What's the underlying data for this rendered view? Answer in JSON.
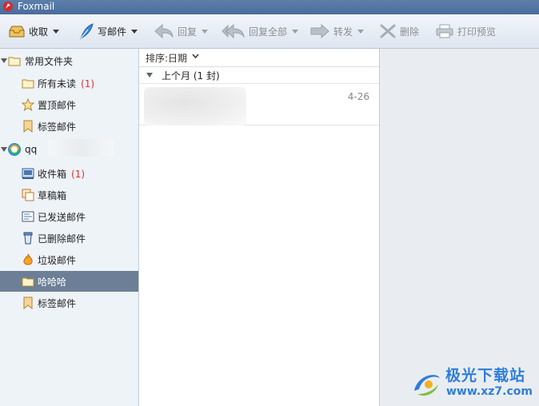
{
  "window": {
    "title": "Foxmail"
  },
  "toolbar": {
    "receive": "收取",
    "compose": "写邮件",
    "reply": "回复",
    "reply_all": "回复全部",
    "forward": "转发",
    "delete": "删除",
    "print_preview": "打印预览"
  },
  "sidebar": {
    "favorites": {
      "label": "常用文件夹",
      "items": [
        {
          "label": "所有未读",
          "count": "(1)"
        },
        {
          "label": "置顶邮件"
        },
        {
          "label": "标签邮件"
        }
      ]
    },
    "account": {
      "label": "qq",
      "items": [
        {
          "label": "收件箱",
          "count": "(1)"
        },
        {
          "label": "草稿箱"
        },
        {
          "label": "已发送邮件"
        },
        {
          "label": "已删除邮件"
        },
        {
          "label": "垃圾邮件"
        },
        {
          "label": "哈哈哈"
        },
        {
          "label": "标签邮件"
        }
      ]
    }
  },
  "message_list": {
    "sort_label": "排序:日期",
    "group_label": "上个月 (1 封)",
    "messages": [
      {
        "date": "4-26"
      }
    ]
  },
  "watermark": {
    "brand": "极光下载站",
    "url": "www.xz7.com"
  },
  "colors": {
    "selected_row": "#6c7f97",
    "unread_count": "#e03030",
    "watermark": "#2f7ed8"
  }
}
